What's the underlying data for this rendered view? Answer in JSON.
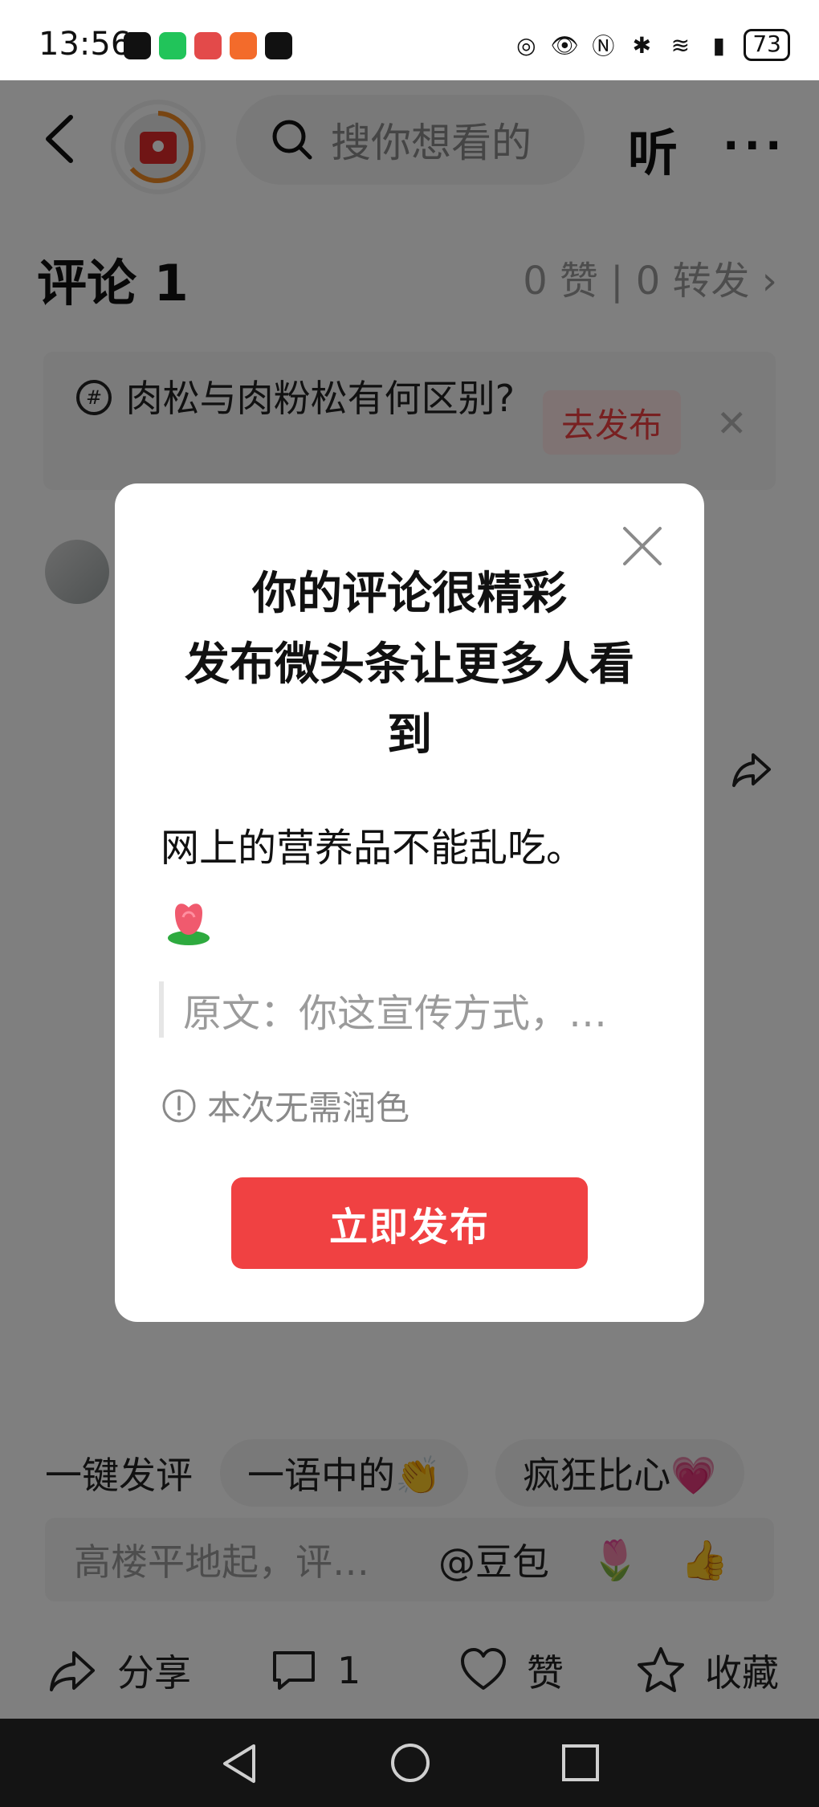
{
  "status_bar": {
    "time": "13:56",
    "battery": "73"
  },
  "header": {
    "search_placeholder": "搜你想看的",
    "listen_label": "听",
    "more_label": "···"
  },
  "comments": {
    "title": "评论 1",
    "stats": "0 赞 | 0 转发",
    "topic_text": "肉松与肉粉松有何区别?",
    "topic_button": "去发布"
  },
  "dialog": {
    "title_line1": "你的评论很精彩",
    "title_line2": "发布微头条让更多人看到",
    "body_text": "网上的营养品不能乱吃。",
    "quote_text": "原文：你这宣传方式，…",
    "hint_text": "本次无需润色",
    "publish_button": "立即发布"
  },
  "quick_comments": {
    "label": "一键发评",
    "chips": [
      "一语中的👏",
      "疯狂比心💗"
    ]
  },
  "input_bar": {
    "placeholder": "高楼平地起，评…",
    "at_doubao": "@豆包",
    "emoji1": "🌷",
    "emoji2": "👍"
  },
  "actions": {
    "share": "分享",
    "comment_count": "1",
    "like": "赞",
    "favorite": "收藏"
  },
  "colors": {
    "accent": "#f04142",
    "overlay": "rgba(0,0,0,0.5)"
  }
}
